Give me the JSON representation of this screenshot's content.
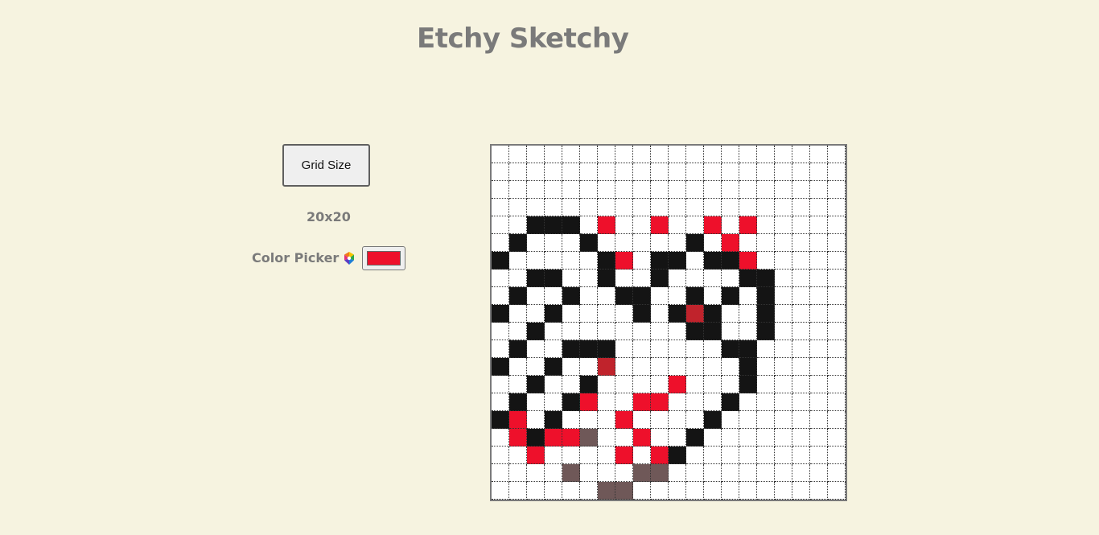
{
  "app": {
    "title": "Etchy Sketchy"
  },
  "controls": {
    "grid_size_button_label": "Grid Size",
    "grid_size_value": "20x20",
    "color_picker_label": "Color Picker",
    "color_picker_icon": "palette-icon",
    "selected_color": "#ee102b"
  },
  "grid": {
    "size": 20,
    "palette": {
      "w": "#ffffff",
      "k": "#141414",
      "r": "#ee102b",
      "d": "#c0232c",
      "g": "#6f5858"
    },
    "rows": [
      "wwwwwwwwwwwwwwwwwwww",
      "wwwwwwwwwwwwwwwwwwww",
      "wwwwwwwwwwwwwwwwwwww",
      "wwwwwwwwwwwwwwwwwwww",
      "wwkkkwrwwrwwrwrwwwww",
      "wkwwwkwwwwwkwrwwwwww",
      "kwwwwwkrwkkwkkrwwwww",
      "wwkkwwkwwkwwwwkkwwww",
      "wkwwkwwkkwwkwkwkwwww",
      "kwwkwwwwkwkdkwwkwwww",
      "wwkwwwwwwwwkkwwkwwww",
      "wkwwkkkwwwwwwkkwwwww",
      "kwwkwwdwwwwwwwkwwwww",
      "wwkwwkwwwwrwwwkwwwww",
      "wkwwkrwwrrwwwkwwwwww",
      "krwkwwwrwwwwkwwwwwww",
      "wrkrrgwwrwwkwwwwwwww",
      "wwrwwwwrwrkwwwwwwwww",
      "wwwwgwwwggwwwwwwwwww",
      "wwwwwwggwwwwwwwwwwww"
    ]
  }
}
